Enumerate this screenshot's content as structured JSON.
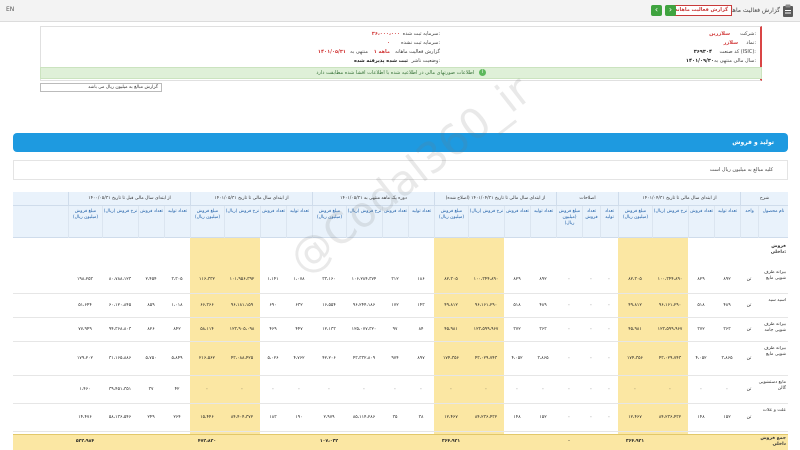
{
  "topbar": {
    "title": "گزارش فعالیت ماهانه",
    "badge": "گزارش فعالیت ماهانه",
    "left_text": "EN",
    "prev": "‹",
    "next": "›"
  },
  "info": {
    "company_label": "شرکت:",
    "company_value": "سلازرین",
    "symbol_label": "نماد:",
    "symbol_value": "سلازر",
    "isic_label": "کد صنعت (ISIC):",
    "isic_value": "۳۶۹۳۰۴",
    "fiscal_label": "سال مالی منتهی به:",
    "fiscal_value": "۱۴۰۱/۰۹/۳۰",
    "capital_label": "سرمایه ثبت شده:",
    "capital_value": "۳۶،۰۰۰،۰۰۰",
    "unreg_label": "سرمایه ثبت نشده:",
    "unreg_value": "۰",
    "report_label": "گزارش فعالیت ماهانه",
    "period_label": "۱ ماهه",
    "period_end_label": "منتهی به",
    "period_end_value": "۱۴۰۱/۰۵/۳۱",
    "status_label": "وضعیت ناشر:",
    "status_value": "ثبت شده پذیرفته شده"
  },
  "notice": "اطلاعات صورتهای مالی در اطلاعیه شده با اطلاعات افشا شده مطابقت دارد",
  "select_box": "گزارش مبالغ به میلیون ریال می باشد",
  "section": {
    "title": "تولید و فروش",
    "unit_note": "کلیه مبالغ به میلیون ریال است"
  },
  "table": {
    "group_headers": [
      "شرح",
      "از ابتدای سال مالی تا تاریخ ۱۴۰۱/۰۴/۳۱",
      "اصلاحات",
      "از ابتدای سال مالی تا تاریخ ۱۴۰۱/۰۴/۳۱ (اصلاح شده)",
      "دوره یک ماهه منتهی به ۱۴۰۱/۰۵/۳۱",
      "از ابتدای سال مالی تا تاریخ ۱۴۰۱/۰۵/۳۱",
      "از ابتدای سال مالی قبل تا تاریخ ۱۴۰۰/۰۵/۳۱"
    ],
    "columns": [
      "نام محصول",
      "واحد",
      "تعداد تولید",
      "تعداد فروش",
      "نرخ فروش (ریال)",
      "مبلغ فروش (میلیون ریال)",
      "تعداد تولید",
      "تعداد فروش",
      "مبلغ فروش (میلیون ریال)",
      "تعداد تولید",
      "تعداد فروش",
      "نرخ فروش (ریال)",
      "مبلغ فروش (میلیون ریال)",
      "تعداد تولید",
      "تعداد فروش",
      "نرخ فروش (ریال)",
      "مبلغ فروش (میلیون ریال)",
      "تعداد تولید",
      "تعداد فروش",
      "نرخ فروش (ریال)",
      "مبلغ فروش (میلیون ریال)",
      "تعداد تولید",
      "تعداد فروش",
      "نرخ فروش (ریال)",
      "مبلغ فروش (میلیون ریال)"
    ],
    "subheader": "فروش داخلی:",
    "rows": [
      {
        "name": "بیرانه ظرف شویی مایع",
        "cells": [
          "تن",
          "۸۹۲",
          "۸۲۹",
          "۱۰۰،۳۴۴،۸۹۰",
          "۸۲،۳۰۵",
          "۰",
          "۰",
          "۰",
          "۸۹۲",
          "۸۲۹",
          "۱۰۰،۳۴۴،۸۹۰",
          "۸۲،۳۰۵",
          "۱۸۶",
          "۳۱۲",
          "۱۰۶،۲۸۴،۳۷۴",
          "۳۳،۱۶۰",
          "۱،۰۷۸",
          "۱،۱۴۱",
          "۱۰۱،۹۵۶،۳۹۲",
          "۱۱۶،۳۳۲",
          "۳،۳۰۵",
          "۲،۴۵۴",
          "۸۰،۷۸۸،۱۲۳",
          "۱۹۸،۲۵۳"
        ]
      },
      {
        "name": "اسید سید",
        "cells": [
          "تن",
          "۴۸۹",
          "۵۱۸",
          "۹۶،۱۶۱،۲۹۰",
          "۴۹،۸۱۲",
          "۰",
          "۰",
          "۰",
          "۴۸۹",
          "۵۱۸",
          "۹۶،۱۶۱،۲۹۰",
          "۴۹،۸۱۲",
          "۱۴۳",
          "۱۷۲",
          "۹۶،۲۴۴،۱۸۶",
          "۱۶،۵۵۴",
          "۶۳۲",
          "۶۹۰",
          "۹۶،۱۸۱،۱۵۹",
          "۶۶،۳۶۶",
          "۱،۰۱۸",
          "۸۵۹",
          "۶۰،۱۲۰،۸۴۵",
          "۵۱،۶۴۴"
        ]
      },
      {
        "name": "بیرانه ظرف شویی جامد",
        "cells": [
          "تن",
          "۳۶۳",
          "۳۷۲",
          "۱۲۳،۵۹۹،۹۶۷",
          "۴۵،۹۸۱",
          "۰",
          "۰",
          "۰",
          "۳۶۳",
          "۳۷۲",
          "۱۲۳،۵۹۹،۹۶۷",
          "۴۵،۹۸۱",
          "۸۴",
          "۹۷",
          "۱۲۵،۰۷۷،۳۲۰",
          "۱۲،۱۳۳",
          "۴۴۷",
          "۴۶۹",
          "۱۲۳،۹۰۵،۰۹۸",
          "۵۸،۱۱۴",
          "۸۴۲",
          "۸۲۶",
          "۹۴،۳۶۸،۸۰۳",
          "۷۷،۹۴۹"
        ]
      },
      {
        "name": "بیرانه ظرف شویی مایع",
        "cells": [
          "تن",
          "۳،۸۶۵",
          "۴،۰۵۲",
          "۴۳،۰۲۹،۷۴۳",
          "۱۷۴،۳۵۶",
          "۰",
          "۰",
          "۰",
          "۳،۸۶۵",
          "۴،۰۵۲",
          "۴۳،۰۲۹،۷۴۳",
          "۱۷۴،۳۵۶",
          "۸۹۷",
          "۹۷۴",
          "۴۳،۳۳۲،۸۰۹",
          "۴۲،۲۰۶",
          "۴،۷۶۲",
          "۵،۰۲۶",
          "۴۳،۰۸۸،۴۲۵",
          "۲۱۶،۵۶۲",
          "۵،۸۴۹",
          "۵،۷۵۰",
          "۳۱،۱۶۵،۸۸۶",
          "۱۷۹،۲۰۲"
        ]
      },
      {
        "name": "مایع دستشویی گالن",
        "cells": [
          "تن",
          "۰",
          "۰",
          "۰",
          "۰",
          "۰",
          "۰",
          "۰",
          "۰",
          "۰",
          "۰",
          "۰",
          "۰",
          "۰",
          "۰",
          "۰",
          "۰",
          "۰",
          "۰",
          "۰",
          "۴۲",
          "۳۷",
          "۳۹،۴۵۱،۳۵۱",
          "۱،۴۶۰"
        ]
      },
      {
        "name": "علت و علات",
        "cells": [
          "تن",
          "۱۵۲",
          "۱۴۸",
          "۸۴،۲۳۶،۴۳۲",
          "۱۲،۴۶۷",
          "۰",
          "۰",
          "۰",
          "۱۵۲",
          "۱۴۸",
          "۸۴،۲۳۶،۴۳۲",
          "۱۲،۴۶۷",
          "۳۸",
          "۳۵",
          "۸۵،۱۱۴،۲۸۶",
          "۲،۹۷۹",
          "۱۹۰",
          "۱۸۳",
          "۸۴،۴۰۴،۳۷۲",
          "۱۵،۴۴۶",
          "۲۶۴",
          "۲۴۹",
          "۵۸،۱۳۶،۵۴۶",
          "۱۴،۴۷۶"
        ]
      }
    ],
    "total": {
      "name": "جمع فروش داخلی",
      "cells": [
        "",
        "",
        "",
        "",
        "۳۶۴،۹۲۱",
        "",
        "",
        "۰",
        "",
        "",
        "",
        "۳۶۴،۹۲۱",
        "",
        "",
        "",
        "۱۰۷،۰۳۲",
        "",
        "",
        "",
        "۴۷۲،۸۲۰",
        "",
        "",
        "",
        "۵۲۲،۹۸۴"
      ]
    }
  },
  "watermark": "@Codal360_ir",
  "colors": {
    "accent_blue": "#1e9ae0",
    "highlight_yellow": "#fbe7a3",
    "notice_green": "#dff0d8",
    "badge_red": "#c93a3a"
  }
}
